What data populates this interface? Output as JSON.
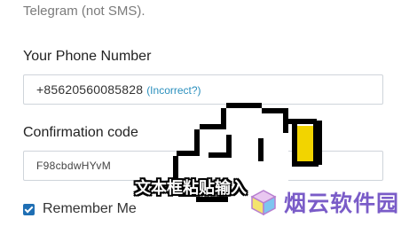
{
  "intro_text": "Telegram (not SMS).",
  "phone": {
    "label": "Your Phone Number",
    "number": "+85620560085828",
    "incorrect_link": "(Incorrect?)"
  },
  "confirmation": {
    "label": "Confirmation code",
    "value": "F98cbdwHYvM"
  },
  "remember": {
    "label": "Remember Me",
    "checked": true
  },
  "overlay": {
    "caption": "文本框粘贴输入",
    "cursor_icon": "pointing-hand-cursor-icon",
    "watermark": "烟云软件园",
    "watermark_icon": "cube-logo-icon"
  },
  "colors": {
    "link": "#2a8fbd",
    "checkbox": "#1f6fb4",
    "cursor_accent": "#f2d400",
    "watermark": "#7a5cc8"
  }
}
